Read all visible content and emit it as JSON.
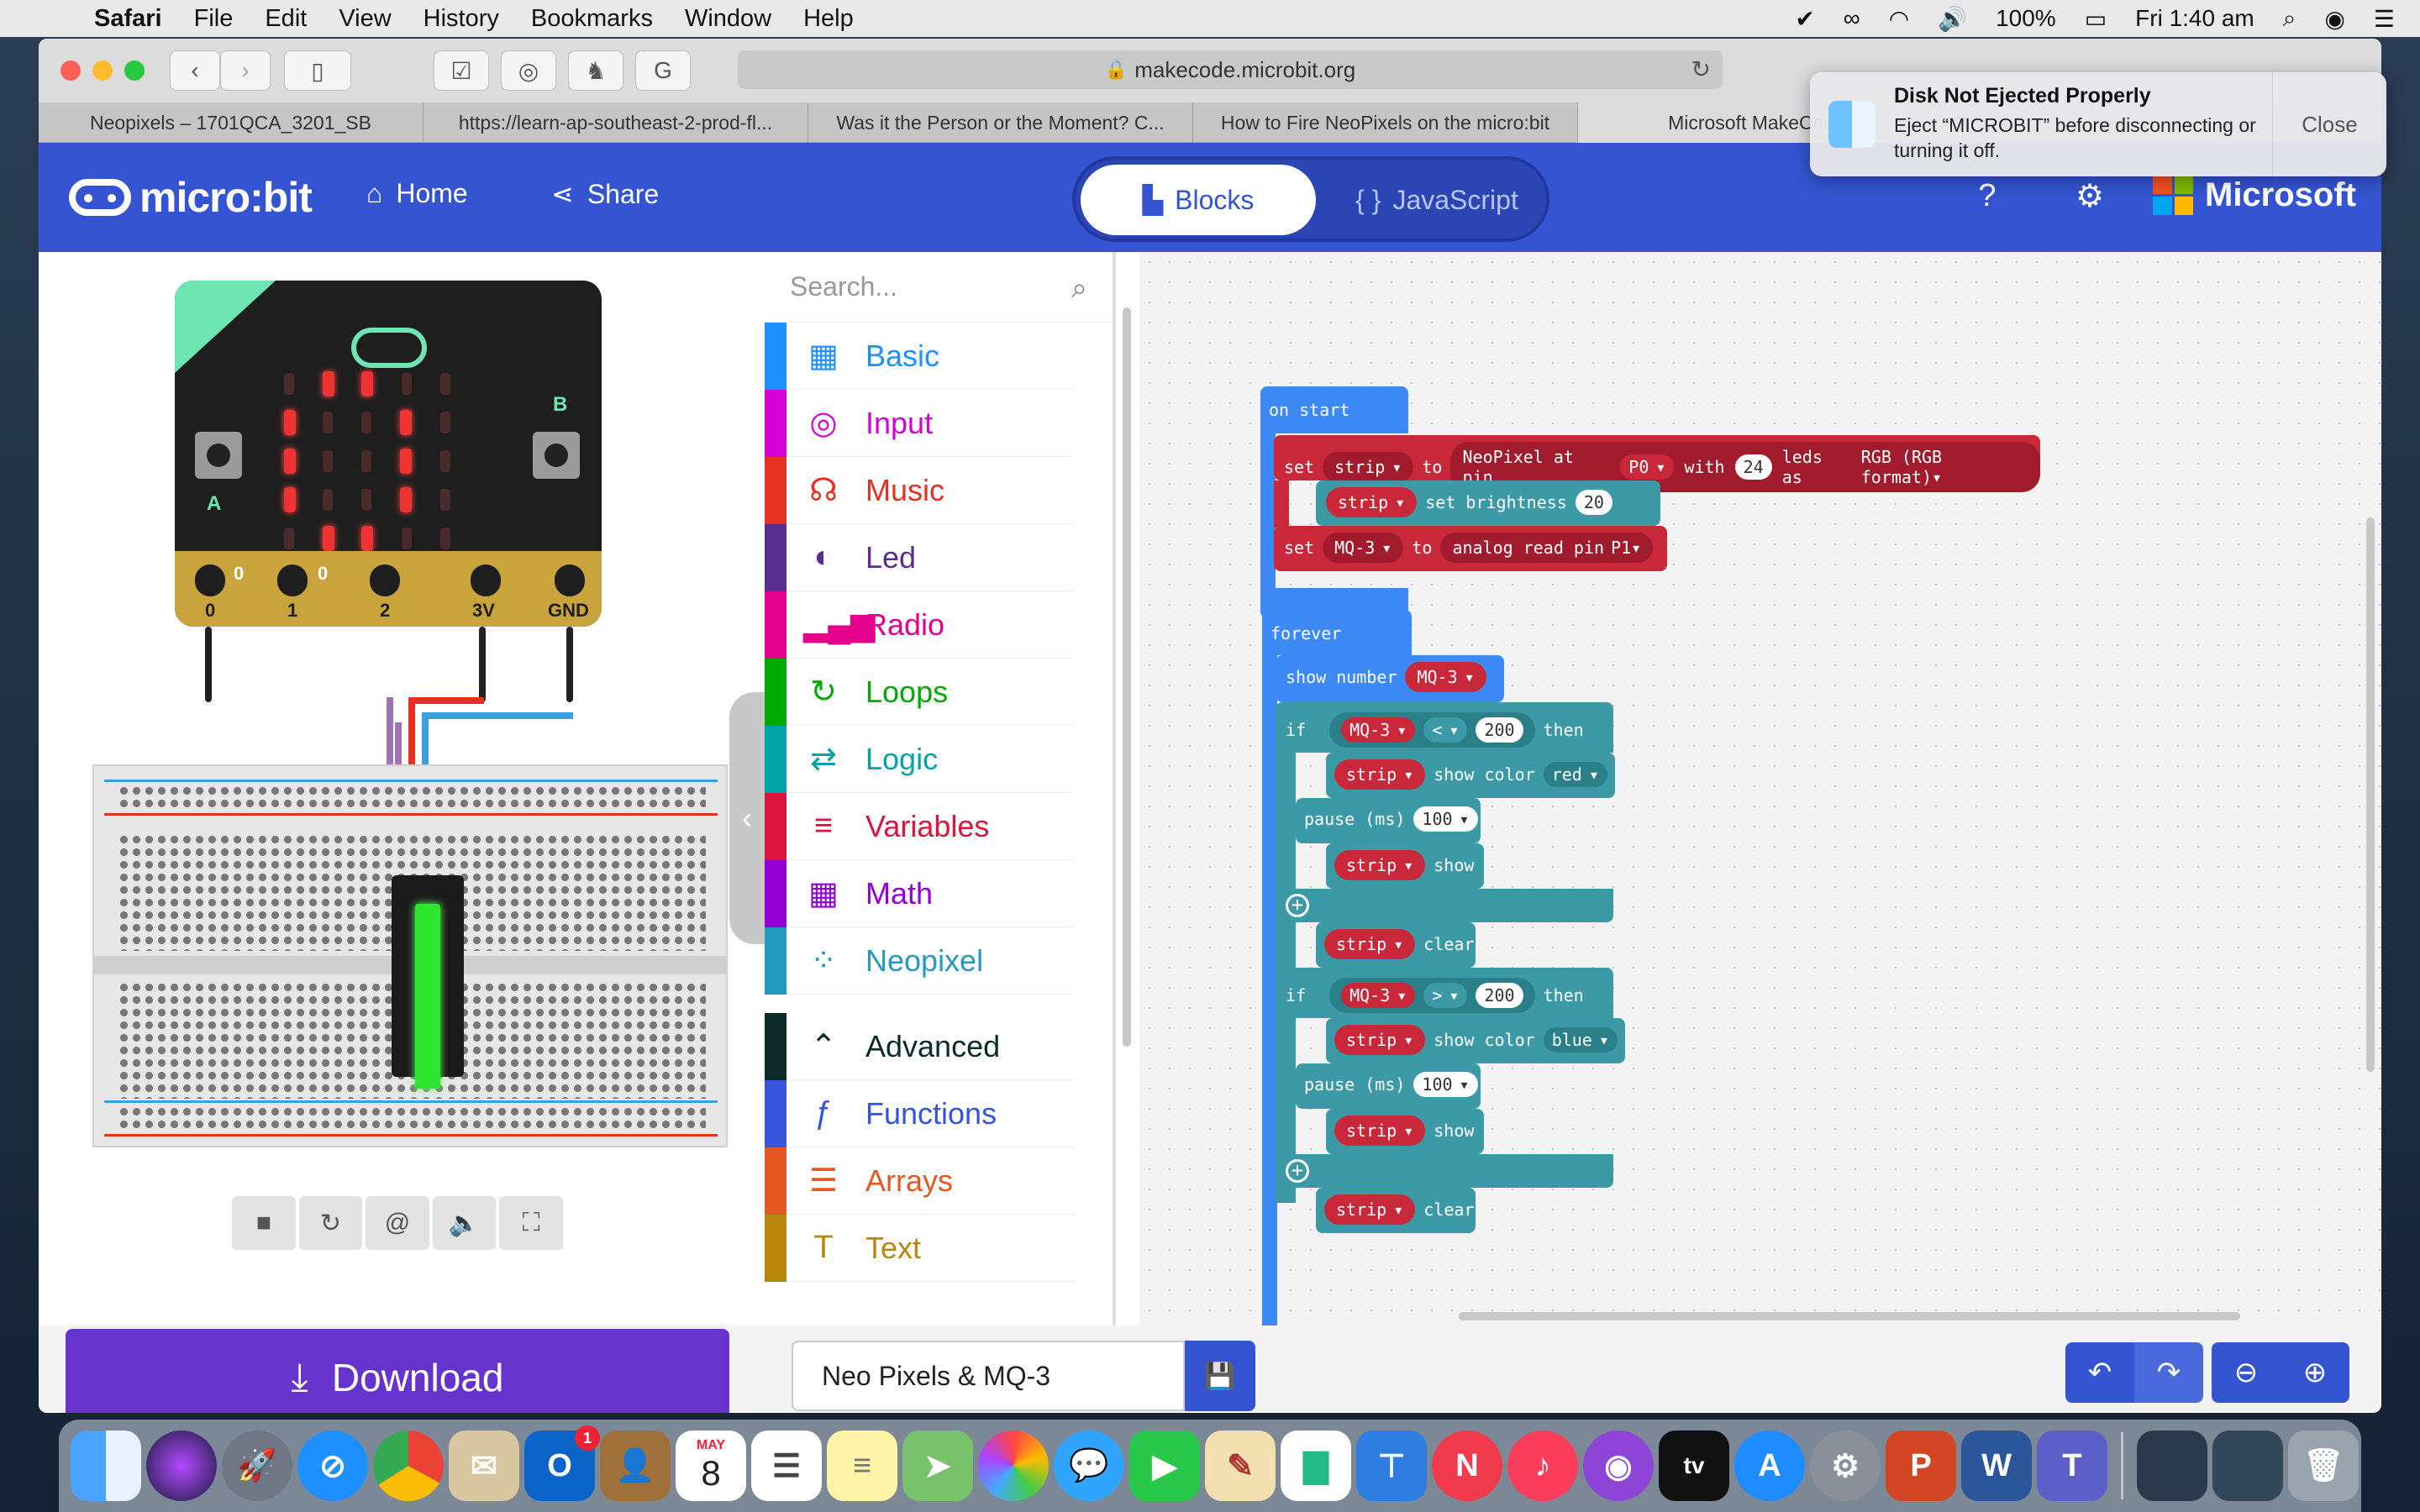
{
  "menubar": {
    "app_name": "Safari",
    "menus": [
      "File",
      "Edit",
      "View",
      "History",
      "Bookmarks",
      "Window",
      "Help"
    ],
    "battery": "100%",
    "clock": "Fri 1:40 am"
  },
  "browser": {
    "url": "makecode.microbit.org",
    "tabs": [
      "Neopixels – 1701QCA_3201_SB",
      "https://learn-ap-southeast-2-prod-fl...",
      "Was it the Person or the Moment? C...",
      "How to Fire NeoPixels on the micro:bit",
      "Microsoft MakeCode f..."
    ]
  },
  "notification": {
    "title": "Disk Not Ejected Properly",
    "body": "Eject “MICROBIT” before disconnecting or turning it off.",
    "close_label": "Close"
  },
  "header": {
    "logo": "micro:bit",
    "home": "Home",
    "share": "Share",
    "mode_blocks": "Blocks",
    "mode_js": "JavaScript",
    "brand": "Microsoft"
  },
  "simulator": {
    "pins": [
      "0",
      "1",
      "2",
      "3V",
      "GND"
    ],
    "pin_values": [
      "0",
      "0"
    ],
    "button_a": "A",
    "button_b": "B"
  },
  "toolbox": {
    "search_placeholder": "Search...",
    "categories": [
      {
        "label": "Basic",
        "color": "#1e90ff",
        "icon": "grid-icon"
      },
      {
        "label": "Input",
        "color": "#d400d4",
        "icon": "target-icon"
      },
      {
        "label": "Music",
        "color": "#e63022",
        "icon": "headphones-icon"
      },
      {
        "label": "Led",
        "color": "#5c2d91",
        "icon": "toggle-icon"
      },
      {
        "label": "Radio",
        "color": "#e3008c",
        "icon": "signal-icon"
      },
      {
        "label": "Loops",
        "color": "#00aa00",
        "icon": "loop-icon"
      },
      {
        "label": "Logic",
        "color": "#00a4a6",
        "icon": "shuffle-icon"
      },
      {
        "label": "Variables",
        "color": "#dc143c",
        "icon": "lines-icon"
      },
      {
        "label": "Math",
        "color": "#9400d3",
        "icon": "calculator-icon"
      },
      {
        "label": "Neopixel",
        "color": "#2699bf",
        "icon": "dots-ring-icon"
      },
      {
        "label": "Advanced",
        "color": "#0d2b2b",
        "icon": "chevron-up-icon"
      },
      {
        "label": "Functions",
        "color": "#3455db",
        "icon": "function-icon"
      },
      {
        "label": "Arrays",
        "color": "#e65722",
        "icon": "list-numbered-icon"
      },
      {
        "label": "Text",
        "color": "#b8860b",
        "icon": "text-icon"
      }
    ]
  },
  "blocks": {
    "on_start": "on start",
    "set": "set",
    "strip": "strip",
    "to": "to",
    "neopixel_at_pin": "NeoPixel at pin",
    "pin_p0": "P0",
    "with": "with",
    "led_count": "24",
    "leds_as": "leds as",
    "rgb_format": "RGB (RGB format)",
    "set_brightness": "set brightness",
    "brightness": "20",
    "mq3": "MQ-3",
    "analog_read_pin": "analog read pin",
    "pin_p1": "P1",
    "forever": "forever",
    "show_number": "show number",
    "if": "if",
    "then": "then",
    "op_lt": "<",
    "op_gt": ">",
    "threshold": "200",
    "show_color": "show color",
    "red": "red",
    "blue": "blue",
    "pause_ms": "pause (ms)",
    "pause_val": "100",
    "show": "show",
    "clear": "clear"
  },
  "bottom": {
    "download": "Download",
    "project_name": "Neo Pixels & MQ-3"
  },
  "dock": {
    "calendar_month": "MAY",
    "calendar_day": "8",
    "outlook_badge": "1",
    "tv_label": "tv"
  }
}
